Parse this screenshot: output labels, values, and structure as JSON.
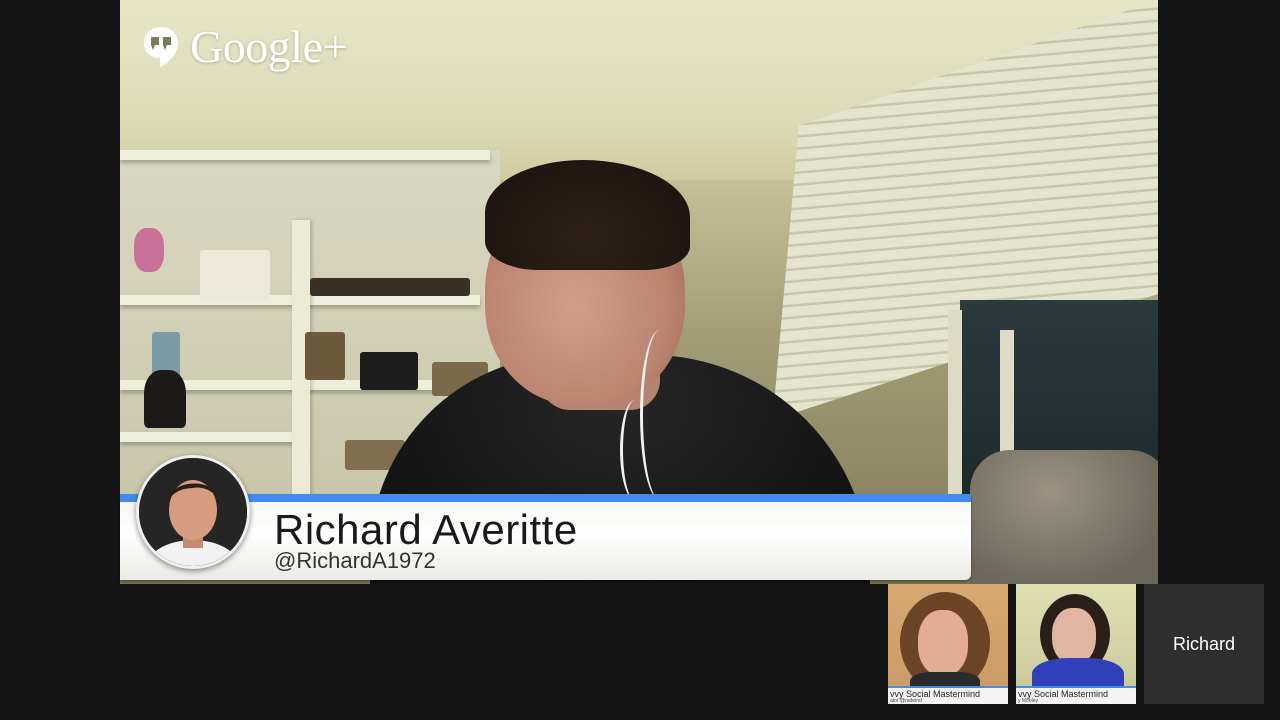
{
  "branding": {
    "logo_text": "Google+",
    "icon": "hangouts-quote-icon"
  },
  "main_speaker": {
    "name": "Richard Averitte",
    "handle": "@RichardA1972"
  },
  "participants": [
    {
      "banner_text": "vvy Social Mastermind",
      "sub_text": "ator @radeind"
    },
    {
      "banner_text": "vvy Social Mastermind",
      "sub_text": "y Mobley"
    },
    {
      "label": "Richard"
    }
  ],
  "colors": {
    "accent": "#3f8cf0",
    "background": "#141414"
  }
}
